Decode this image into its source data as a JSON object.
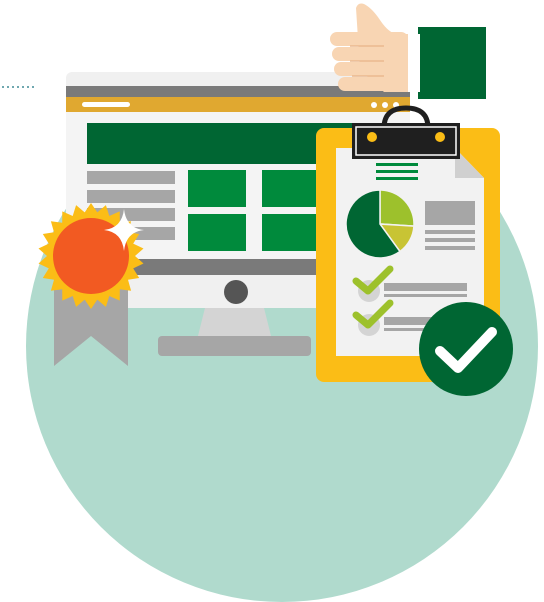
{
  "illustration": {
    "colors": {
      "background_circle": "#b0dacd",
      "dark_green": "#006633",
      "mid_green": "#008a3c",
      "lime_green": "#9dc12c",
      "yellow": "#fbbd16",
      "gold_bar": "#e0a830",
      "orange": "#f25a22",
      "skin": "#f8d5b3",
      "grey": "#a6a6a6",
      "light_grey": "#d4d4d4",
      "dark_grey": "#7a7a7a",
      "black": "#1f1f1f",
      "white": "#ffffff"
    },
    "icons": [
      "thumbs-up-icon",
      "desktop-monitor-icon",
      "award-badge-icon",
      "sparkle-icon",
      "clipboard-icon",
      "pie-chart-icon",
      "checkmark-icon",
      "check-circle-icon"
    ],
    "pie_chart": {
      "slices": [
        {
          "label": "",
          "value": 60,
          "color": "#006633"
        },
        {
          "label": "",
          "value": 26,
          "color": "#9dc12c"
        },
        {
          "label": "",
          "value": 14,
          "color": "#c8c434"
        }
      ]
    },
    "checklist": {
      "items": [
        {
          "checked": true
        },
        {
          "checked": true
        }
      ]
    }
  }
}
